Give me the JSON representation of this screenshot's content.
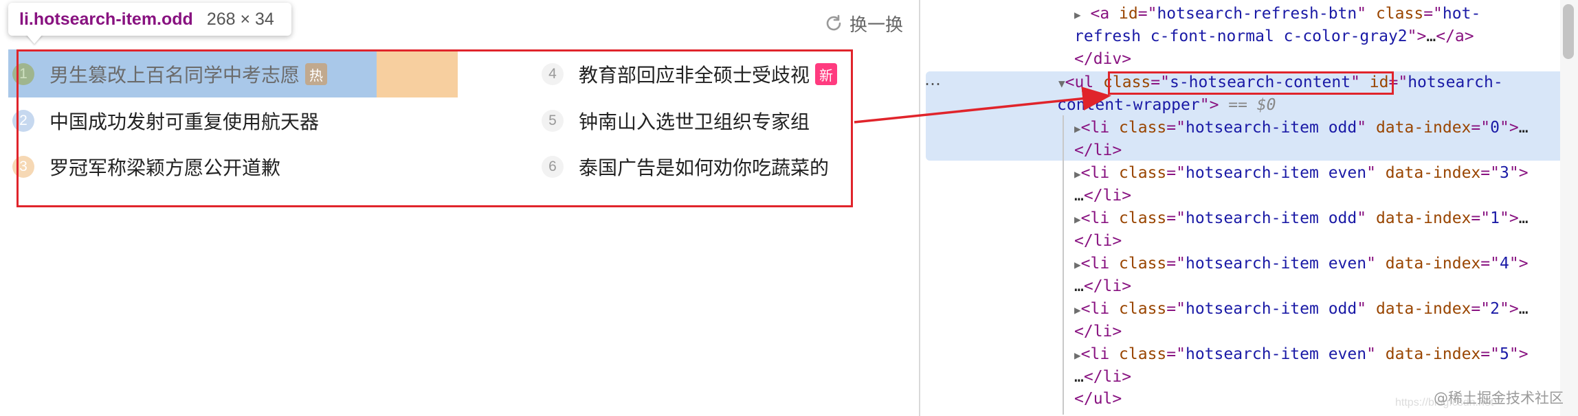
{
  "tooltip": {
    "selector": "li.hotsearch-item.odd",
    "dims": "268 × 34"
  },
  "refresh": {
    "label": "换一换"
  },
  "hotsearch": {
    "items": [
      {
        "num": "1",
        "title": "男生篡改上百名同学中考志愿",
        "badge": "热"
      },
      {
        "num": "2",
        "title": "中国成功发射可重复使用航天器",
        "badge": ""
      },
      {
        "num": "3",
        "title": "罗冠军称梁颖方愿公开道歉",
        "badge": ""
      },
      {
        "num": "4",
        "title": "教育部回应非全硕士受歧视",
        "badge": "新"
      },
      {
        "num": "5",
        "title": "钟南山入选世卫组织专家组",
        "badge": ""
      },
      {
        "num": "6",
        "title": "泰国广告是如何劝你吃蔬菜的",
        "badge": ""
      }
    ]
  },
  "devtools": {
    "line1": {
      "tag_open": "<a ",
      "attr1": "id",
      "eq1": "=\"",
      "val1": "hotsearch-refresh-btn",
      "q1": "\" ",
      "attr2": "class",
      "eq2": "=\"",
      "val2": "hot-"
    },
    "line2": {
      "val": "refresh c-font-normal c-color-gray2",
      "q": "\">",
      "ell": "…",
      "tag": "</a>"
    },
    "line3": {
      "tag": "</div>"
    },
    "ul": {
      "dots": "…",
      "tag": "<ul ",
      "attr1": "class",
      "eq1": "=\"",
      "val1": "s-hotsearch-content",
      "q1": "\" ",
      "attr2": "id",
      "eq2": "=\"",
      "val2": "hotsearch-",
      "val2b": "content-wrapper",
      "q2": "\">",
      "eqsel": " == ",
      "sel": "$0"
    },
    "items": [
      {
        "cls": "hotsearch-item odd",
        "idx": "0"
      },
      {
        "cls": "hotsearch-item even",
        "idx": "3"
      },
      {
        "cls": "hotsearch-item odd",
        "idx": "1"
      },
      {
        "cls": "hotsearch-item even",
        "idx": "4"
      },
      {
        "cls": "hotsearch-item odd",
        "idx": "2"
      },
      {
        "cls": "hotsearch-item even",
        "idx": "5"
      }
    ],
    "li_open": "<li ",
    "li_attr1": "class",
    "li_attr2": "data-index",
    "li_close": "</li>",
    "ul_close": "</ul>"
  },
  "watermark": "@稀土掘金技术社区",
  "url_ghost": "https://blog.csdn.net",
  "colors": {
    "highlight_blue": "#a9c8e9",
    "highlight_orange": "#f7cf9f",
    "annotation_red": "#e0242b",
    "selected_row": "#d8e6f8"
  }
}
